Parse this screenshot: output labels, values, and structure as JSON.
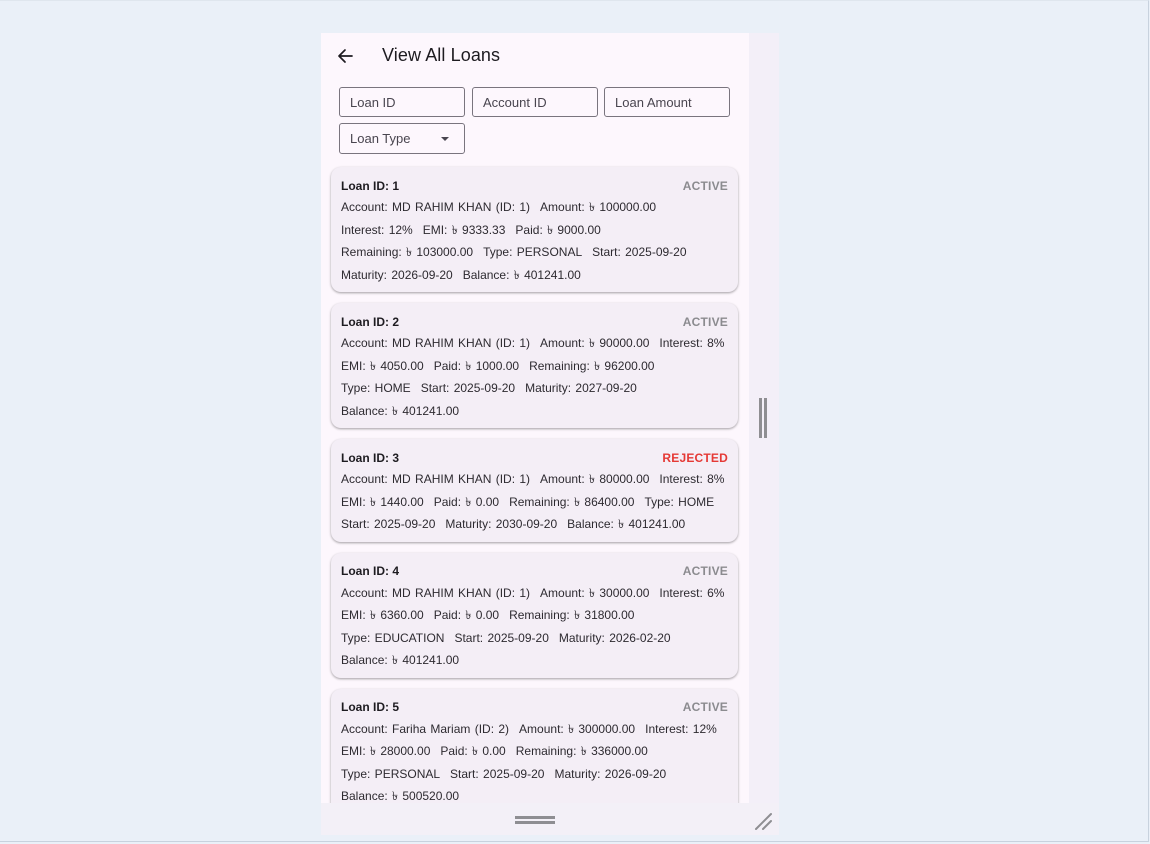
{
  "appbar": {
    "title": "View All Loans"
  },
  "filters": {
    "loan_id_placeholder": "Loan ID",
    "account_id_placeholder": "Account ID",
    "loan_amount_placeholder": "Loan Amount",
    "loan_type_label": "Loan Type"
  },
  "loans": [
    {
      "id": "Loan ID: 1",
      "status": "ACTIVE",
      "lines": [
        [
          "Account: MD RAHIM KHAN (ID: 1)",
          "Amount: ৳ 100000.00"
        ],
        [
          "Interest: 12%",
          "EMI: ৳ 9333.33",
          "Paid: ৳ 9000.00"
        ],
        [
          "Remaining: ৳ 103000.00",
          "Type: PERSONAL",
          "Start: 2025-09-20"
        ],
        [
          "Maturity: 2026-09-20",
          "Balance: ৳ 401241.00"
        ]
      ]
    },
    {
      "id": "Loan ID: 2",
      "status": "ACTIVE",
      "lines": [
        [
          "Account: MD RAHIM KHAN (ID: 1)",
          "Amount: ৳ 90000.00",
          "Interest: 8%"
        ],
        [
          "EMI: ৳ 4050.00",
          "Paid: ৳ 1000.00",
          "Remaining: ৳ 96200.00"
        ],
        [
          "Type: HOME",
          "Start: 2025-09-20",
          "Maturity: 2027-09-20"
        ],
        [
          "Balance: ৳ 401241.00"
        ]
      ]
    },
    {
      "id": "Loan ID: 3",
      "status": "REJECTED",
      "lines": [
        [
          "Account: MD RAHIM KHAN (ID: 1)",
          "Amount: ৳ 80000.00",
          "Interest: 8%"
        ],
        [
          "EMI: ৳ 1440.00",
          "Paid: ৳ 0.00",
          "Remaining: ৳ 86400.00",
          "Type: HOME"
        ],
        [
          "Start: 2025-09-20",
          "Maturity: 2030-09-20",
          "Balance: ৳ 401241.00"
        ]
      ]
    },
    {
      "id": "Loan ID: 4",
      "status": "ACTIVE",
      "lines": [
        [
          "Account: MD RAHIM KHAN (ID: 1)",
          "Amount: ৳ 30000.00",
          "Interest: 6%"
        ],
        [
          "EMI: ৳ 6360.00",
          "Paid: ৳ 0.00",
          "Remaining: ৳ 31800.00"
        ],
        [
          "Type: EDUCATION",
          "Start: 2025-09-20",
          "Maturity: 2026-02-20"
        ],
        [
          "Balance: ৳ 401241.00"
        ]
      ]
    },
    {
      "id": "Loan ID: 5",
      "status": "ACTIVE",
      "lines": [
        [
          "Account: Fariha Mariam (ID: 2)",
          "Amount: ৳ 300000.00",
          "Interest: 12%"
        ],
        [
          "EMI: ৳ 28000.00",
          "Paid: ৳ 0.00",
          "Remaining: ৳ 336000.00"
        ],
        [
          "Type: PERSONAL",
          "Start: 2025-09-20",
          "Maturity: 2026-09-20"
        ],
        [
          "Balance: ৳ 500520.00"
        ]
      ]
    }
  ],
  "colors": {
    "status_active": "#8b8b8f",
    "status_rejected": "#e53935",
    "card_bg": "#f4eef6",
    "app_bg": "#fdf7fd"
  }
}
